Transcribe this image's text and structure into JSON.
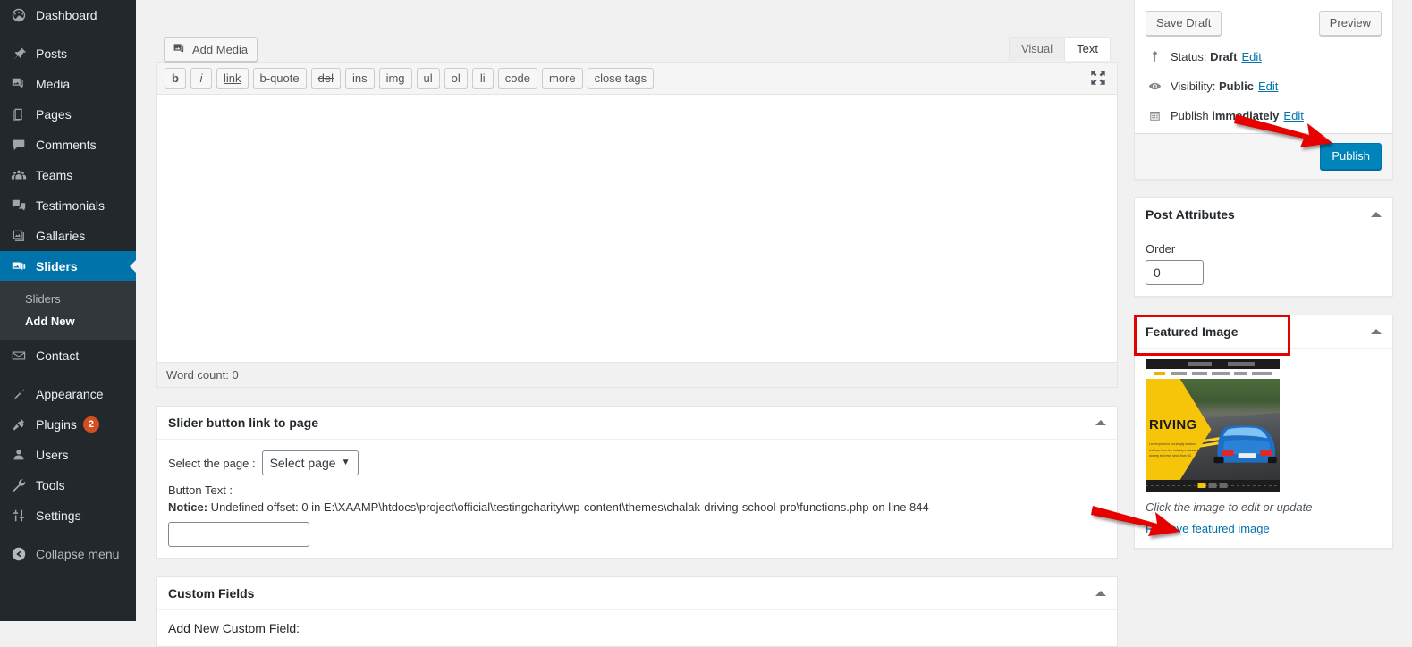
{
  "sidebar": {
    "items": [
      {
        "label": "Dashboard",
        "icon": "dashboard-icon",
        "name": "dashboard"
      },
      {
        "label": "Posts",
        "icon": "pin-icon",
        "name": "posts"
      },
      {
        "label": "Media",
        "icon": "media-icon",
        "name": "media"
      },
      {
        "label": "Pages",
        "icon": "pages-icon",
        "name": "pages"
      },
      {
        "label": "Comments",
        "icon": "comments-icon",
        "name": "comments"
      },
      {
        "label": "Teams",
        "icon": "groups-icon",
        "name": "teams"
      },
      {
        "label": "Testimonials",
        "icon": "testimonials-icon",
        "name": "testimonials"
      },
      {
        "label": "Gallaries",
        "icon": "gallery-icon",
        "name": "gallaries"
      },
      {
        "label": "Sliders",
        "icon": "sliders-icon",
        "name": "sliders",
        "current": true
      },
      {
        "label": "Contact",
        "icon": "envelope-icon",
        "name": "contact"
      },
      {
        "label": "Appearance",
        "icon": "appearance-icon",
        "name": "appearance"
      },
      {
        "label": "Plugins",
        "icon": "plugins-icon",
        "name": "plugins",
        "badge": "2"
      },
      {
        "label": "Users",
        "icon": "users-icon",
        "name": "users"
      },
      {
        "label": "Tools",
        "icon": "wrench-icon",
        "name": "tools"
      },
      {
        "label": "Settings",
        "icon": "settings-icon",
        "name": "settings"
      },
      {
        "label": "Collapse menu",
        "icon": "collapse-icon",
        "name": "collapse-menu"
      }
    ],
    "submenu": {
      "parent": "Sliders",
      "items": [
        {
          "label": "Sliders",
          "current": false
        },
        {
          "label": "Add New",
          "current": true
        }
      ]
    }
  },
  "editor": {
    "add_media_label": "Add Media",
    "tabs": [
      {
        "label": "Visual",
        "active": false
      },
      {
        "label": "Text",
        "active": true
      }
    ],
    "quicktags": [
      "b",
      "i",
      "link",
      "b-quote",
      "del",
      "ins",
      "img",
      "ul",
      "ol",
      "li",
      "code",
      "more",
      "close tags"
    ],
    "content": "",
    "word_count": "Word count: 0",
    "fullscreen_icon": "fullscreen-icon"
  },
  "slider_link_box": {
    "title": "Slider button link to page",
    "select_label": "Select the page :",
    "select_value": "Select page",
    "button_text_label": "Button Text :",
    "notice_prefix": "Notice:",
    "notice_text": " Undefined offset: 0 in E:\\XAAMP\\htdocs\\project\\official\\testingcharity\\wp-content\\themes\\chalak-driving-school-pro\\functions.php on line 844",
    "button_text_value": ""
  },
  "custom_fields_box": {
    "title": "Custom Fields",
    "add_new_label": "Add New Custom Field:"
  },
  "publish_box": {
    "save_draft_label": "Save Draft",
    "preview_label": "Preview",
    "status_label": "Status:",
    "status_value": "Draft",
    "visibility_label": "Visibility:",
    "visibility_value": "Public",
    "publish_label": "Publish",
    "publish_value": "immediately",
    "edit_label": "Edit",
    "publish_button_label": "Publish"
  },
  "post_attributes_box": {
    "title": "Post Attributes",
    "order_label": "Order",
    "order_value": "0"
  },
  "featured_image_box": {
    "title": "Featured Image",
    "hint": "Click the image to edit or update",
    "remove_label": "Remove featured image",
    "thumbnail_alt": "Driving school website screenshot with blue car",
    "thumbnail_hero_title": "RIVING",
    "thumbnail_hero_sub": "Lorem ipsum is not simply random text has been the industry's standard dummy text ever since from BC."
  },
  "colors": {
    "admin_bg": "#23282d",
    "submenu_bg": "#32373c",
    "accent_blue": "#0073aa",
    "primary_button": "#0085ba",
    "link_blue": "#0073aa",
    "badge_orange": "#d54e21",
    "annotation_red": "#e60000",
    "page_bg": "#f1f1f1"
  }
}
